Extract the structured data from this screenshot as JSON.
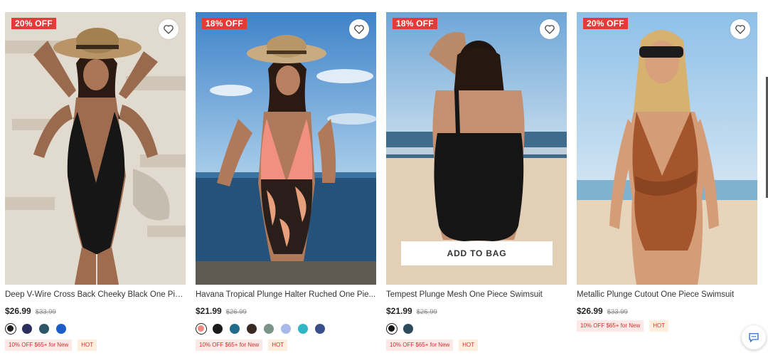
{
  "products": [
    {
      "badge": "20% OFF",
      "title": "Deep V-Wire Cross Back Cheeky Black One Pie...",
      "price": "$26.99",
      "original_price": "$33.99",
      "swatches": [
        "#1e1e1e",
        "#2c2f5c",
        "#2f5666",
        "#1c5cc8"
      ],
      "selected_swatch": 0,
      "promo_tag": "10% OFF $65+ for New",
      "hot_tag": "HOT",
      "show_add_to_bag": false,
      "swimsuit_color": "#161616"
    },
    {
      "badge": "18% OFF",
      "title": "Havana Tropical Plunge Halter Ruched One Pie...",
      "price": "$21.99",
      "original_price": "$26.99",
      "swatches": [
        "#f08a7e",
        "#1b1b1b",
        "#1f6d8a",
        "#3a2a22",
        "#7a9488",
        "#a8b8e8",
        "#2fb5c6",
        "#3b4e8c"
      ],
      "selected_swatch": 0,
      "promo_tag": "10% OFF $65+ for New",
      "hot_tag": "HOT",
      "show_add_to_bag": false,
      "swimsuit_color": "#f2907f"
    },
    {
      "badge": "18% OFF",
      "title": "Tempest Plunge Mesh One Piece Swimsuit",
      "price": "$21.99",
      "original_price": "$26.99",
      "swatches": [
        "#141414",
        "#2e4a5c"
      ],
      "selected_swatch": 0,
      "promo_tag": "10% OFF $65+ for New",
      "hot_tag": "HOT",
      "show_add_to_bag": true,
      "add_to_bag_label": "ADD TO BAG",
      "swimsuit_color": "#151515"
    },
    {
      "badge": "20% OFF",
      "title": "Metallic Plunge Cutout One Piece Swimsuit",
      "price": "$26.99",
      "original_price": "$33.99",
      "swatches": [],
      "selected_swatch": -1,
      "promo_tag": "10% OFF $65+ for New",
      "hot_tag": "HOT",
      "show_add_to_bag": false,
      "swimsuit_color": "#a4552b"
    }
  ],
  "icons": {
    "wishlist": "heart-icon",
    "chat": "chat-bubble-icon"
  },
  "colors": {
    "badge_bg": "#e33a3a",
    "promo_bg": "#fde8e8",
    "hot_bg": "#fdeede"
  }
}
